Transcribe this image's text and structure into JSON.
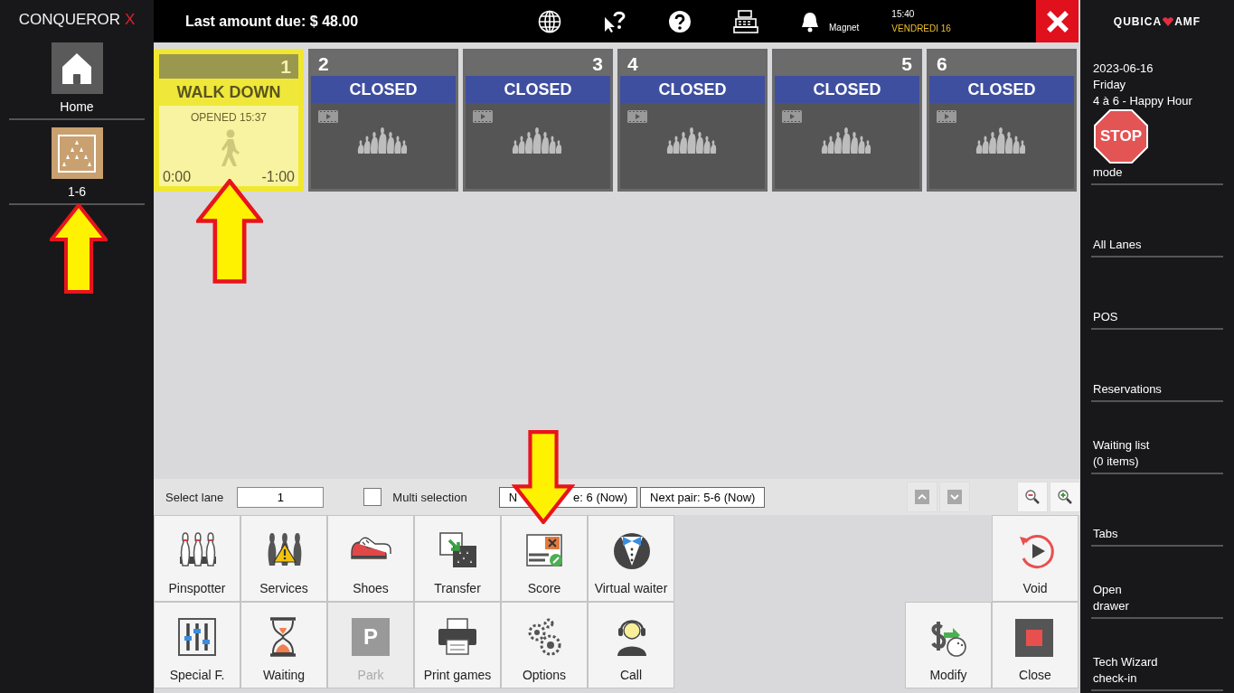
{
  "left_sidebar": {
    "brand": "CONQUEROR",
    "brand_mark": "X",
    "items": [
      {
        "label": "Home",
        "kind": "home"
      },
      {
        "label": "1-6",
        "kind": "lanes"
      }
    ]
  },
  "top_bar": {
    "last_amount": "Last amount due: $ 48.00",
    "user": "Magnet",
    "time": "15:40",
    "day": "VENDREDI 16"
  },
  "lanes": [
    {
      "number": "1",
      "status": "WALK DOWN",
      "kind": "open",
      "selected": true,
      "opened": "OPENED 15:37",
      "elapsed": "0:00",
      "remaining": "-1:00"
    },
    {
      "number": "2",
      "status": "CLOSED",
      "kind": "closed",
      "selected": false
    },
    {
      "number": "3",
      "status": "CLOSED",
      "kind": "closed",
      "selected": false
    },
    {
      "number": "4",
      "status": "CLOSED",
      "kind": "closed",
      "selected": false
    },
    {
      "number": "5",
      "status": "CLOSED",
      "kind": "closed",
      "selected": false
    },
    {
      "number": "6",
      "status": "CLOSED",
      "kind": "closed",
      "selected": false
    }
  ],
  "lane_bar": {
    "select_label": "Select lane",
    "select_value": "1",
    "multi_label": "Multi selection",
    "multi_checked": false,
    "next_lane": [
      "N",
      "e: 6 (Now)"
    ],
    "next_pair": "Next pair: 5-6 (Now)"
  },
  "actions": {
    "left": [
      [
        {
          "label": "Pinspotter",
          "kind": "pinspotter",
          "disabled": false
        },
        {
          "label": "Services",
          "kind": "services",
          "disabled": false
        },
        {
          "label": "Shoes",
          "kind": "shoes",
          "disabled": false
        },
        {
          "label": "Transfer",
          "kind": "transfer",
          "disabled": false
        },
        {
          "label": "Score",
          "kind": "score",
          "disabled": false
        },
        {
          "label": "Virtual waiter",
          "kind": "waiter",
          "disabled": false
        }
      ],
      [
        {
          "label": "Special F.",
          "kind": "special",
          "disabled": false
        },
        {
          "label": "Waiting",
          "kind": "waiting",
          "disabled": false
        },
        {
          "label": "Park",
          "kind": "park",
          "disabled": true,
          "icon_text": "P"
        },
        {
          "label": "Print games",
          "kind": "print",
          "disabled": false
        },
        {
          "label": "Options",
          "kind": "options",
          "disabled": false
        },
        {
          "label": "Call",
          "kind": "call",
          "disabled": false
        }
      ]
    ],
    "right": [
      [
        {
          "label": "Void",
          "kind": "void",
          "disabled": false
        }
      ],
      [
        {
          "label": "Modify",
          "kind": "modify",
          "disabled": false
        },
        {
          "label": "Close",
          "kind": "close",
          "disabled": false
        }
      ]
    ]
  },
  "right_panel": {
    "logo_left": "QUBICA",
    "logo_right": "AMF",
    "date_lines": [
      "2023-06-16",
      "Friday",
      "4 à 6 - Happy Hour"
    ],
    "items": [
      {
        "lines": [
          "mode"
        ]
      },
      {
        "lines": [
          "All Lanes"
        ]
      },
      {
        "lines": [
          "POS"
        ]
      },
      {
        "lines": [
          "Reservations"
        ]
      },
      {
        "lines": [
          "Waiting list",
          "(0 items)"
        ]
      },
      {
        "lines": [
          "Tabs"
        ]
      },
      {
        "lines": [
          "Open",
          "drawer"
        ]
      },
      {
        "lines": [
          "Tech Wizard",
          "check-in"
        ]
      }
    ]
  },
  "stop_sign": {
    "text": "STOP"
  }
}
